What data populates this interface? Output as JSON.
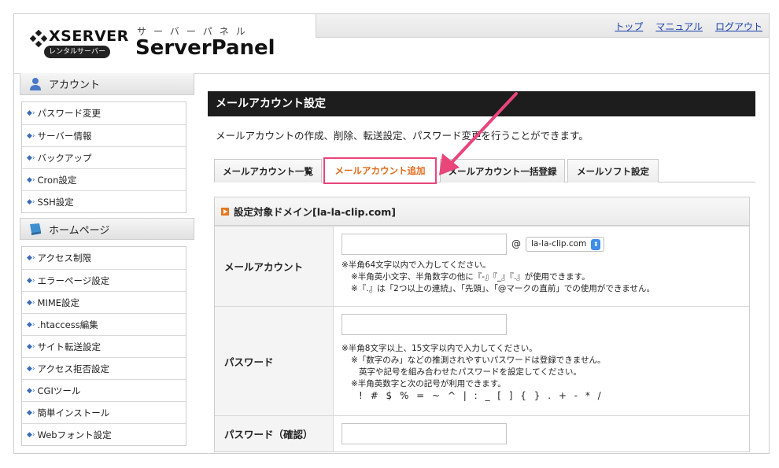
{
  "header": {
    "logo_text": "XSERVER",
    "logo_badge": "レンタルサーバー",
    "logo_kana": "サーバーパネル",
    "logo_product": "ServerPanel",
    "nav": [
      "トップ",
      "マニュアル",
      "ログアウト"
    ]
  },
  "sidebar": {
    "sections": [
      {
        "title": "アカウント",
        "icon": "user-icon",
        "items": [
          "パスワード変更",
          "サーバー情報",
          "バックアップ",
          "Cron設定",
          "SSH設定"
        ]
      },
      {
        "title": "ホームページ",
        "icon": "monitor-icon",
        "items": [
          "アクセス制限",
          "エラーページ設定",
          "MIME設定",
          ".htaccess編集",
          "サイト転送設定",
          "アクセス拒否設定",
          "CGIツール",
          "簡単インストール",
          "Webフォント設定"
        ]
      }
    ]
  },
  "main": {
    "title": "メールアカウント設定",
    "description": "メールアカウントの作成、削除、転送設定、パスワード変更を行うことができます。",
    "tabs": [
      {
        "label": "メールアカウント一覧",
        "active": false
      },
      {
        "label": "メールアカウント追加",
        "active": true
      },
      {
        "label": "メールアカウント一括登録",
        "active": false
      },
      {
        "label": "メールソフト設定",
        "active": false
      }
    ],
    "panel_title": "設定対象ドメイン[la-la-clip.com]",
    "form": {
      "account_label": "メールアカウント",
      "account_value": "",
      "at": "@",
      "domain_select": "la-la-clip.com",
      "account_notes": [
        "※半角64文字以内で入力してください。",
        "※半角英小文字、半角数字の他に『-』『_』『.』が使用できます。",
        "※『.』は「2つ以上の連続」、「先頭」、「@マークの直前」での使用ができません。"
      ],
      "password_label": "パスワード",
      "password_value": "",
      "password_notes": [
        "※半角8文字以上、15文字以内で入力してください。",
        "※「数字のみ」などの推測されやすいパスワードは登録できません。",
        "英字や記号を組み合わせたパスワードを設定してください。",
        "※半角英数字と次の記号が利用できます。",
        "! # $ % = ~ ^ | : _ [ ] { } . + - * /"
      ],
      "confirm_label": "パスワード（確認）",
      "confirm_value": ""
    }
  },
  "colors": {
    "title_bar": "#1d1d1d",
    "active_tab_text": "#e06a1a",
    "highlight": "#e8457a",
    "link": "#1a3fa8"
  }
}
